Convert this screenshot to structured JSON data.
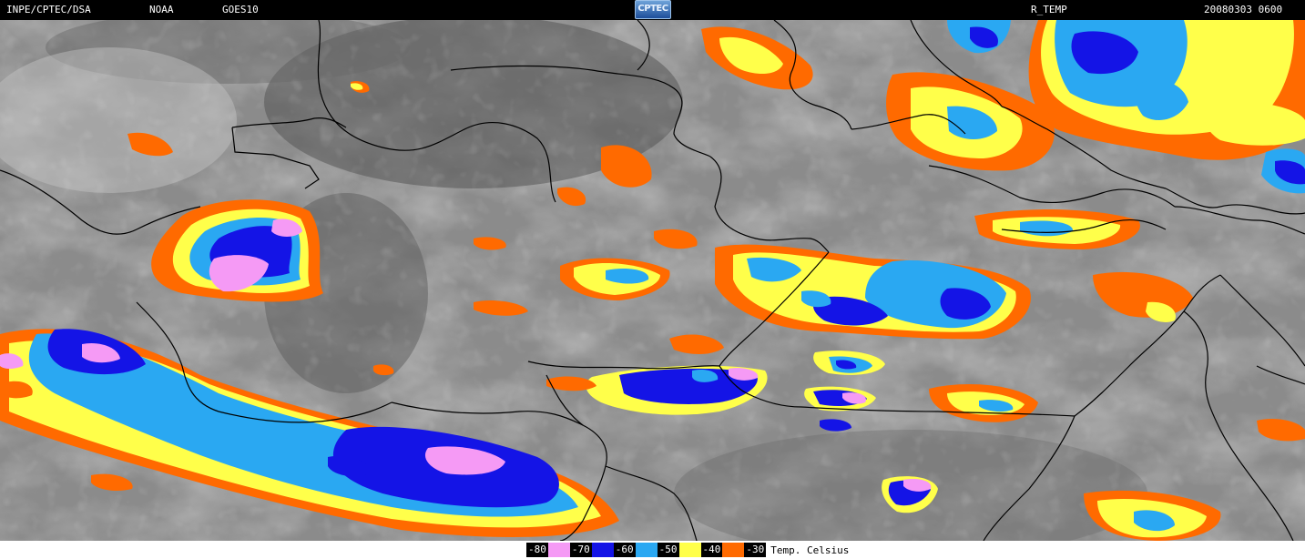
{
  "header": {
    "source": "INPE/CPTEC/DSA",
    "agency": "NOAA",
    "satellite": "GOES10",
    "logo_text": "CPTEC",
    "product": "R_TEMP",
    "timestamp": "20080303 0600"
  },
  "legend": {
    "items": [
      {
        "label": "-80",
        "color": "#f59af5"
      },
      {
        "label": "-70",
        "color": "#1414e6"
      },
      {
        "label": "-60",
        "color": "#2aa8f2"
      },
      {
        "label": "-50",
        "color": "#ffff4a"
      },
      {
        "label": "-40",
        "color": "#ff6a00"
      },
      {
        "label": "-30",
        "color": "#8a8a8a"
      }
    ],
    "units": "Temp. Celsius"
  },
  "palette": {
    "background": "#8b8b8b",
    "light_cloud": "#bdbdbd",
    "dark_area": "#5a5a5a",
    "borders": "#000000"
  }
}
